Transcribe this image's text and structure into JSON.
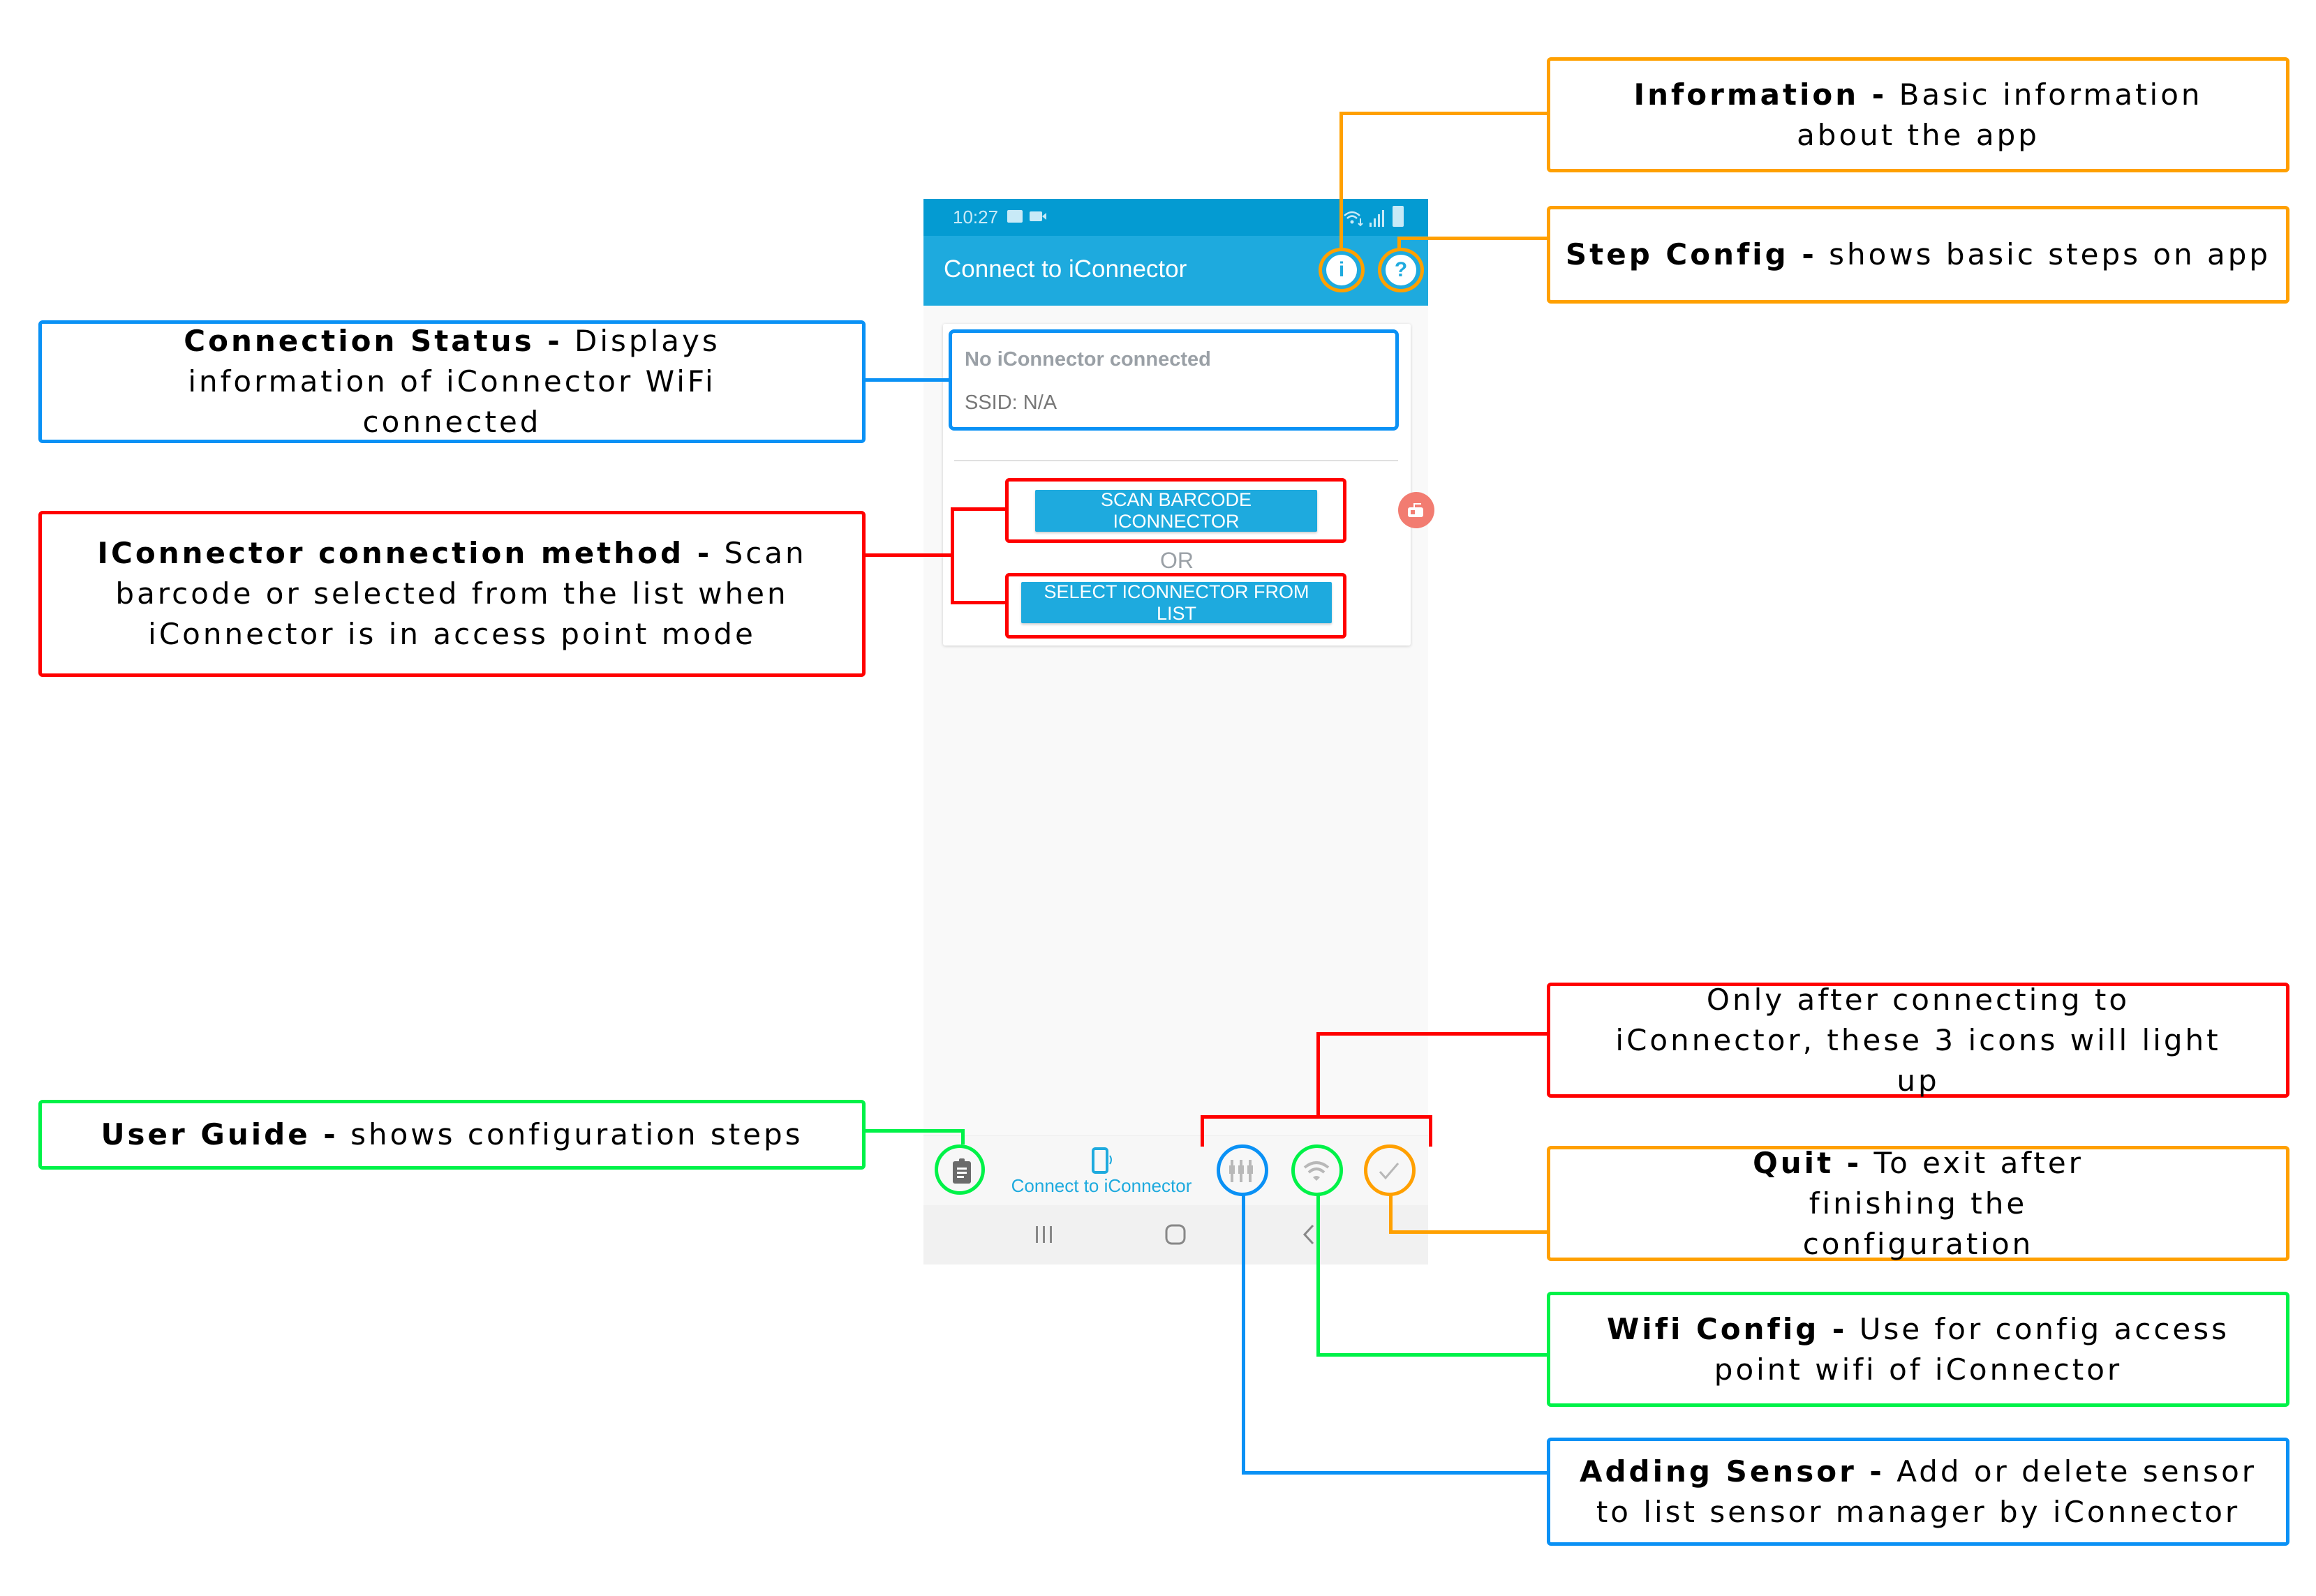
{
  "phone": {
    "status_bar": {
      "time": "10:27",
      "left_icons": [
        "image-icon",
        "video-camera-icon"
      ],
      "right_icons": [
        "wifi-data-icon",
        "signal-icon",
        "battery-icon"
      ]
    },
    "app_bar": {
      "title": "Connect to iConnector",
      "info_icon_glyph": "i",
      "help_icon_glyph": "?"
    },
    "connection_card": {
      "status_title": "No iConnector connected",
      "ssid_text": "SSID: N/A",
      "scan_button_label": "SCAN BARCODE ICONNECTOR",
      "or_label": "OR",
      "select_button_label": "SELECT ICONNECTOR FROM LIST"
    },
    "bottom_nav": {
      "items": [
        {
          "name": "user-guide",
          "label": ""
        },
        {
          "name": "connect",
          "label": "Connect to iConnector",
          "active": true
        },
        {
          "name": "adding-sensor",
          "label": ""
        },
        {
          "name": "wifi-config",
          "label": ""
        },
        {
          "name": "quit",
          "label": ""
        }
      ]
    }
  },
  "annotations": {
    "information": {
      "title": "Information -",
      "text": " Basic information about the app"
    },
    "step_config": {
      "title": "Step Config -",
      "text": " shows basic steps on app"
    },
    "connection_status": {
      "title": "Connection Status -",
      "text": " Displays information of iConnector WiFi connected"
    },
    "connection_method": {
      "title": "IConnector connection method -",
      "text": " Scan barcode or selected from the list when iConnector is in access point mode"
    },
    "light_up": {
      "title": "",
      "text": "Only after connecting to iConnector, these 3 icons will light up"
    },
    "user_guide": {
      "title": "User Guide -",
      "text": " shows configuration steps"
    },
    "quit": {
      "title": "Quit -",
      "text": " To exit after finishing the configuration"
    },
    "wifi_config": {
      "title": "Wifi Config -",
      "text": " Use for config access point wifi of iConnector"
    },
    "adding_sensor": {
      "title": "Adding Sensor -",
      "text": " Add or delete sensor to list sensor manager by iConnector"
    }
  },
  "colors": {
    "app_primary": "#1eaade",
    "status_bar": "#049bd2",
    "anno_blue": "#0a91f5",
    "anno_red": "#ff0000",
    "anno_orange": "#ffa000",
    "anno_green": "#00f248"
  }
}
